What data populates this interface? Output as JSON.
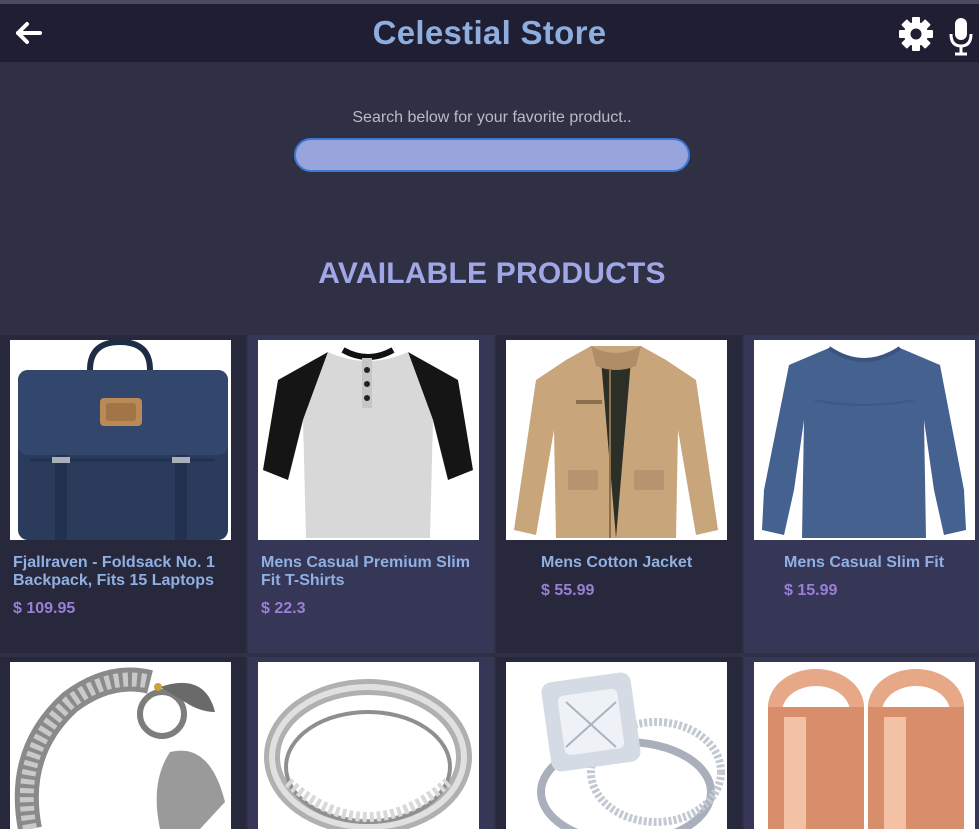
{
  "header": {
    "title": "Celestial Store",
    "back_icon": "arrow-left-icon",
    "settings_icon": "gear-icon",
    "mic_icon": "microphone-icon"
  },
  "search": {
    "label": "Search below for your favorite product..",
    "value": "",
    "placeholder": ""
  },
  "section_title": "AVAILABLE PRODUCTS",
  "colors": {
    "header_bg": "#1f1e33",
    "page_bg": "#2f3043",
    "title": "#8eaee0",
    "product_name": "#90b0e4",
    "price": "#9b7fd6",
    "search_fill": "#98a4dc",
    "search_border": "#3f78d6"
  },
  "products": [
    {
      "name": "Fjallraven - Foldsack No. 1 Backpack, Fits 15 Laptops",
      "price": "$ 109.95",
      "image": "navy-backpack"
    },
    {
      "name": "Mens Casual Premium Slim Fit T-Shirts",
      "price": "$ 22.3",
      "image": "raglan-henley-tshirt"
    },
    {
      "name": "Mens Cotton Jacket",
      "price": "$ 55.99",
      "image": "khaki-jacket"
    },
    {
      "name": "Mens Casual Slim Fit",
      "price": "$ 15.99",
      "image": "blue-long-sleeve-shirt"
    },
    {
      "name": "",
      "price": "",
      "image": "silver-dragon-bracelet"
    },
    {
      "name": "",
      "price": "",
      "image": "silver-ring"
    },
    {
      "name": "",
      "price": "",
      "image": "diamond-ring-set"
    },
    {
      "name": "",
      "price": "",
      "image": "rose-gold-tunnel-plugs"
    }
  ]
}
